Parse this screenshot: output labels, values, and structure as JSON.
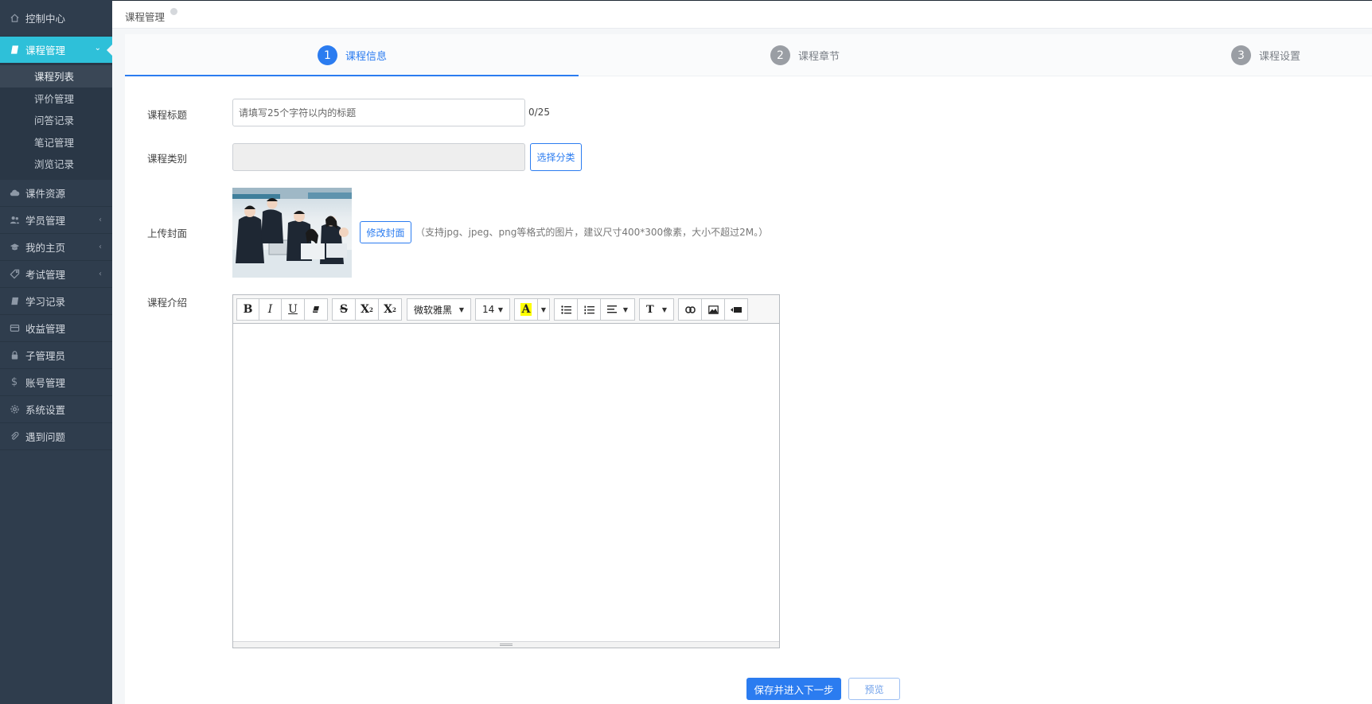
{
  "sidebar": {
    "items": [
      {
        "label": "控制中心"
      },
      {
        "label": "课程管理"
      },
      {
        "label": "课件资源"
      },
      {
        "label": "学员管理"
      },
      {
        "label": "我的主页"
      },
      {
        "label": "考试管理"
      },
      {
        "label": "学习记录"
      },
      {
        "label": "收益管理"
      },
      {
        "label": "子管理员"
      },
      {
        "label": "账号管理"
      },
      {
        "label": "系统设置"
      },
      {
        "label": "遇到问题"
      }
    ],
    "sub_items": [
      {
        "label": "课程列表"
      },
      {
        "label": "评价管理"
      },
      {
        "label": "问答记录"
      },
      {
        "label": "笔记管理"
      },
      {
        "label": "浏览记录"
      }
    ],
    "active_color": "#2ec0d9"
  },
  "header": {
    "breadcrumb": "课程管理"
  },
  "steps": [
    {
      "num": "1",
      "label": "课程信息"
    },
    {
      "num": "2",
      "label": "课程章节"
    },
    {
      "num": "3",
      "label": "课程设置"
    }
  ],
  "form": {
    "title_label": "课程标题",
    "title_placeholder": "请填写25个字符以内的标题",
    "title_counter": "0/25",
    "category_label": "课程类别",
    "category_button": "选择分类",
    "cover_label": "上传封面",
    "cover_button": "修改封面",
    "cover_hint": "（支持jpg、jpeg、png等格式的图片，建议尺寸400*300像素，大小不超过2M。）",
    "intro_label": "课程介绍"
  },
  "editor": {
    "font_family": "微软雅黑",
    "font_size": "14",
    "buttons": {
      "bold": "B",
      "italic": "I",
      "underline": "U",
      "strike": "S",
      "sup": "X",
      "sub": "X",
      "color": "A",
      "text_size": "T"
    }
  },
  "actions": {
    "save_next": "保存并进入下一步",
    "preview": "预览"
  },
  "colors": {
    "primary": "#2b7cf0",
    "sidebar_bg": "#2f3d4d"
  }
}
